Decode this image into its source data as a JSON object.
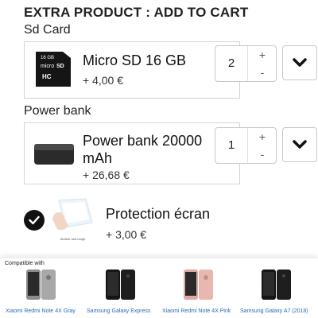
{
  "header": {
    "title": "EXTRA PRODUCT : ADD TO CART"
  },
  "products": [
    {
      "category": "Sd Card",
      "name": "Micro SD 16 GB",
      "price": "+ 4,00 €",
      "quantity": "2",
      "plus": "+",
      "minus": "-",
      "thumb_text": {
        "size": "16 GB",
        "brand": "micro",
        "logo": "SD",
        "class": "HC"
      }
    },
    {
      "category": "Power bank",
      "name_line1": "Power bank 20000",
      "name_line2": "mAh",
      "price": "+ 26,68 €",
      "quantity": "1",
      "plus": "+",
      "minus": "-"
    }
  ],
  "protection": {
    "name": "Protection écran",
    "price": "+ 3,00 €",
    "checked": true,
    "image_caption": "flexible and tough"
  },
  "compatible": {
    "title": "Compatible with",
    "phones": [
      {
        "name": "Xiaomi Redmi Note 4X Gray",
        "color": "#9a9a9a"
      },
      {
        "name": "Samsung Galaxy Express",
        "color": "#1c1c1c"
      },
      {
        "name": "Xiaomi Redmi Note 4X Pink",
        "color": "#e8b8b0"
      },
      {
        "name": "Samsung Galaxy A7 (2018)",
        "color": "#1c1c1c"
      }
    ]
  },
  "colors": {
    "border": "#d4d4d4",
    "link": "#2a6bb5",
    "text": "#222222"
  }
}
